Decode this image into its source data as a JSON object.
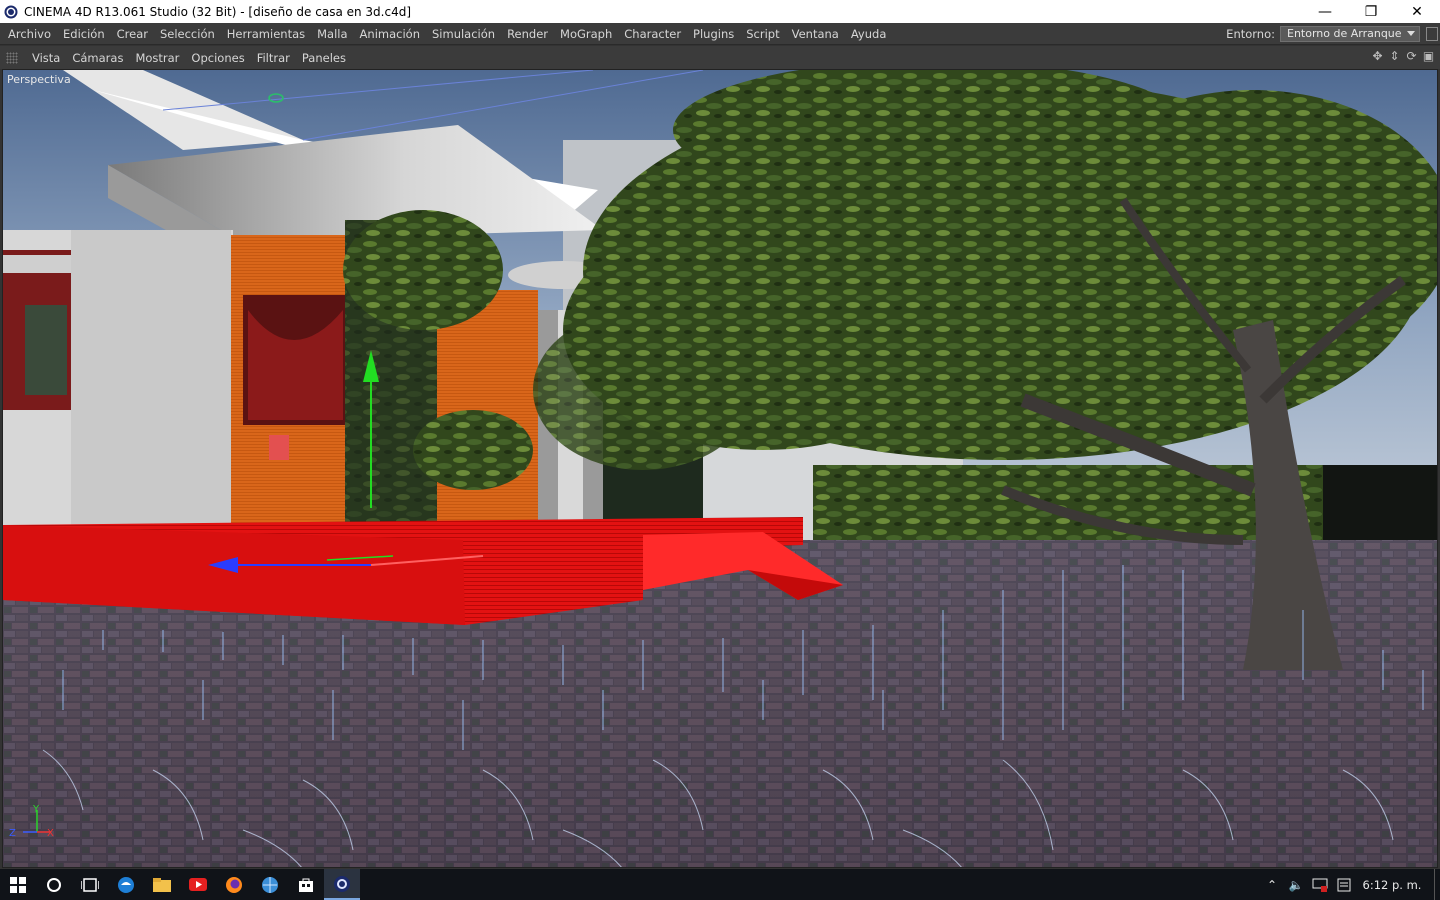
{
  "window": {
    "title": "CINEMA 4D R13.061 Studio (32 Bit) - [diseño de casa en 3d.c4d]",
    "controls": {
      "minimize": "—",
      "maximize": "❐",
      "close": "✕"
    }
  },
  "menubar": {
    "items": [
      "Archivo",
      "Edición",
      "Crear",
      "Selección",
      "Herramientas",
      "Malla",
      "Animación",
      "Simulación",
      "Render",
      "MoGraph",
      "Character",
      "Plugins",
      "Script",
      "Ventana",
      "Ayuda"
    ],
    "environment_label": "Entorno:",
    "environment_value": "Entorno de Arranque"
  },
  "viewport_menu": {
    "items": [
      "Vista",
      "Cámaras",
      "Mostrar",
      "Opciones",
      "Filtrar",
      "Paneles"
    ],
    "icons": [
      "move-view-icon",
      "dolly-view-icon",
      "rotate-view-icon",
      "toggle-panel-icon"
    ]
  },
  "viewport": {
    "label": "Perspectiva",
    "axis": {
      "y": "Y",
      "z": "Z",
      "x": "X"
    }
  },
  "taskbar": {
    "apps": [
      "windows-start-icon",
      "search-icon",
      "task-view-icon",
      "edge-icon",
      "file-explorer-icon",
      "youtube-icon",
      "firefox-icon",
      "internet-icon",
      "store-icon",
      "cinema4d-icon"
    ],
    "tray_icons": [
      "chevron-up-icon",
      "volume-icon",
      "network-icon",
      "notification-icon"
    ],
    "clock": "6:12 p. m."
  }
}
